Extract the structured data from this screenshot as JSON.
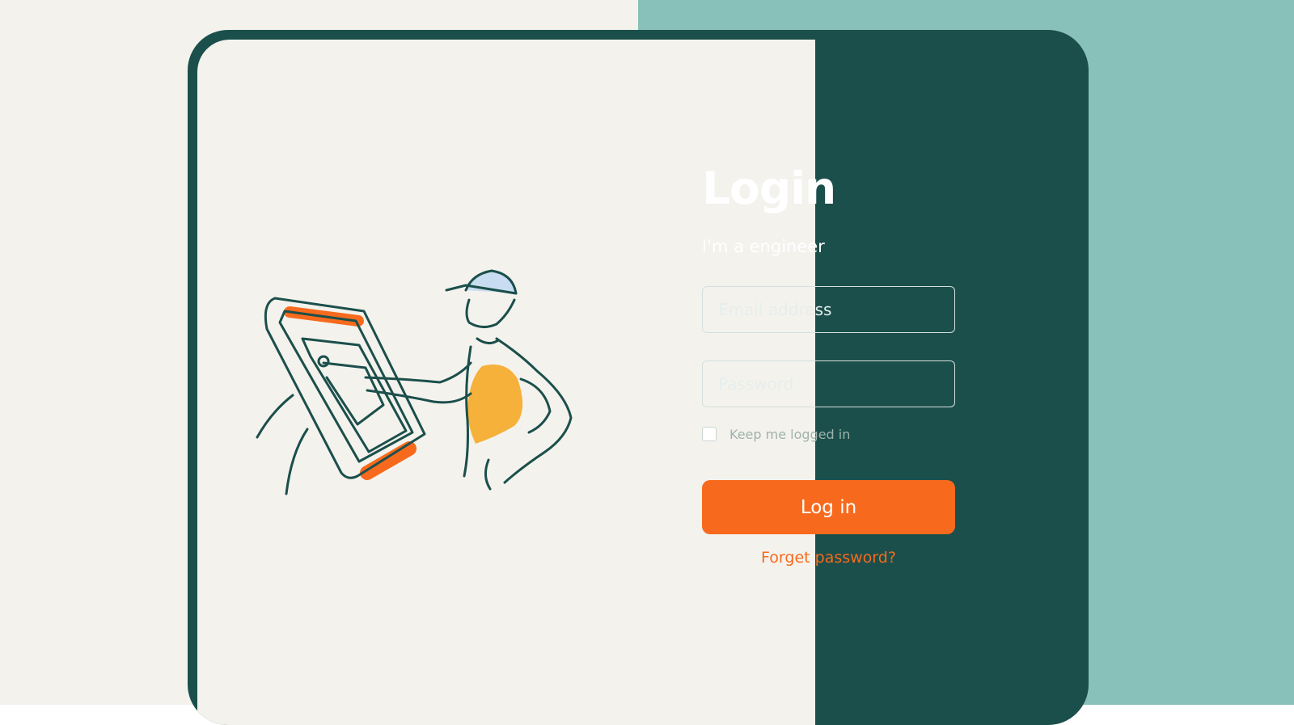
{
  "login": {
    "title": "Login",
    "subtitle": "I'm a engineer",
    "email_placeholder": "Email address",
    "password_placeholder": "Password",
    "remember_label": "Keep me logged in",
    "remember_checked": false,
    "submit_label": "Log in",
    "forgot_label": "Forget password?"
  },
  "illustration": {
    "icon": "engineer-at-touchscreen-kiosk-illustration"
  },
  "colors": {
    "background_left": "#f4f2ed",
    "background_right": "#88c1b9",
    "card_dark": "#1b4f4b",
    "accent_orange": "#f76a1d",
    "accent_yellow": "#f6b13a"
  }
}
